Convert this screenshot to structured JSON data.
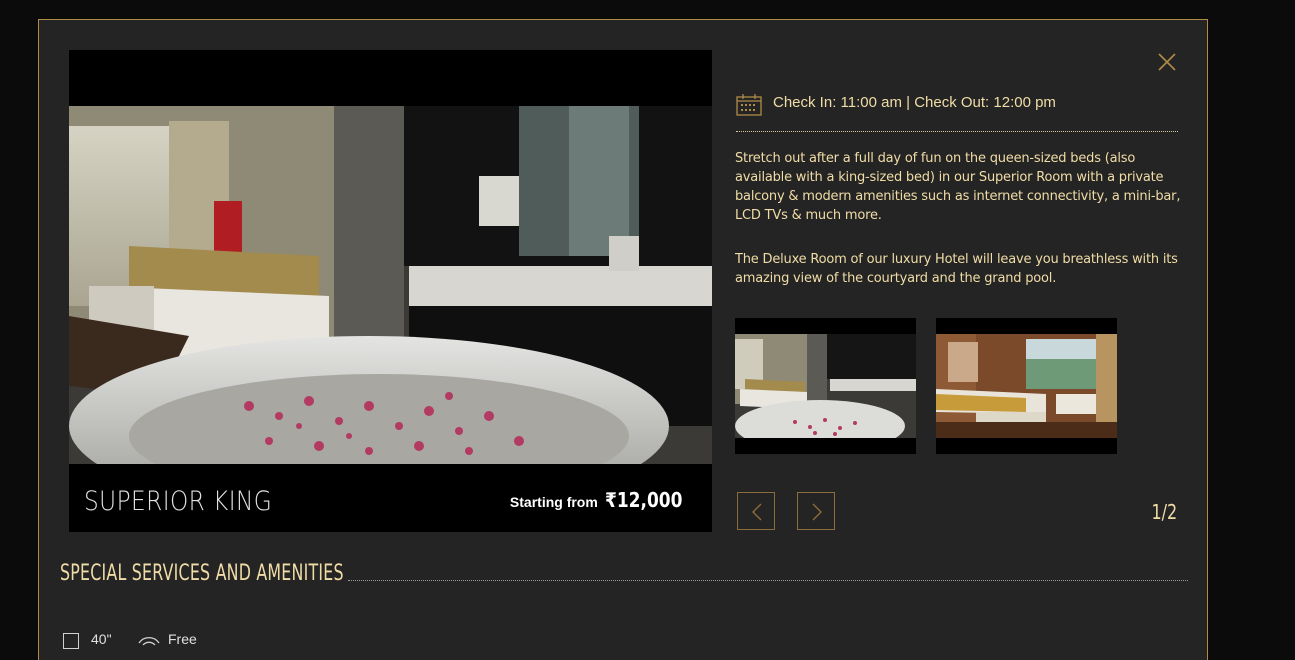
{
  "room": {
    "name": "SUPERIOR KING",
    "price_label": "Starting from",
    "price_value": "₹12,000"
  },
  "details": {
    "checkin_text": "Check In: 11:00 am | Check Out: 12:00 pm",
    "description": [
      "Stretch out after a full day of fun on the queen-sized beds (also available with a king-sized bed) in our Superior Room with a private balcony & modern amenities such as internet connectivity, a mini-bar, LCD TVs & much more.",
      "The Deluxe Room of our luxury Hotel will leave you breathless with its amazing view of the courtyard and the grand pool."
    ],
    "pagination": "1/2"
  },
  "amenities": {
    "title": "SPECIAL SERVICES AND AMENITIES",
    "items": [
      "40\"",
      "Free"
    ]
  },
  "icons": {
    "close": "close-icon",
    "calendar": "calendar-icon",
    "prev": "chevron-left-icon",
    "next": "chevron-right-icon"
  },
  "colors": {
    "accent": "#f0dca6",
    "border": "#b08b48",
    "background": "#242424"
  }
}
